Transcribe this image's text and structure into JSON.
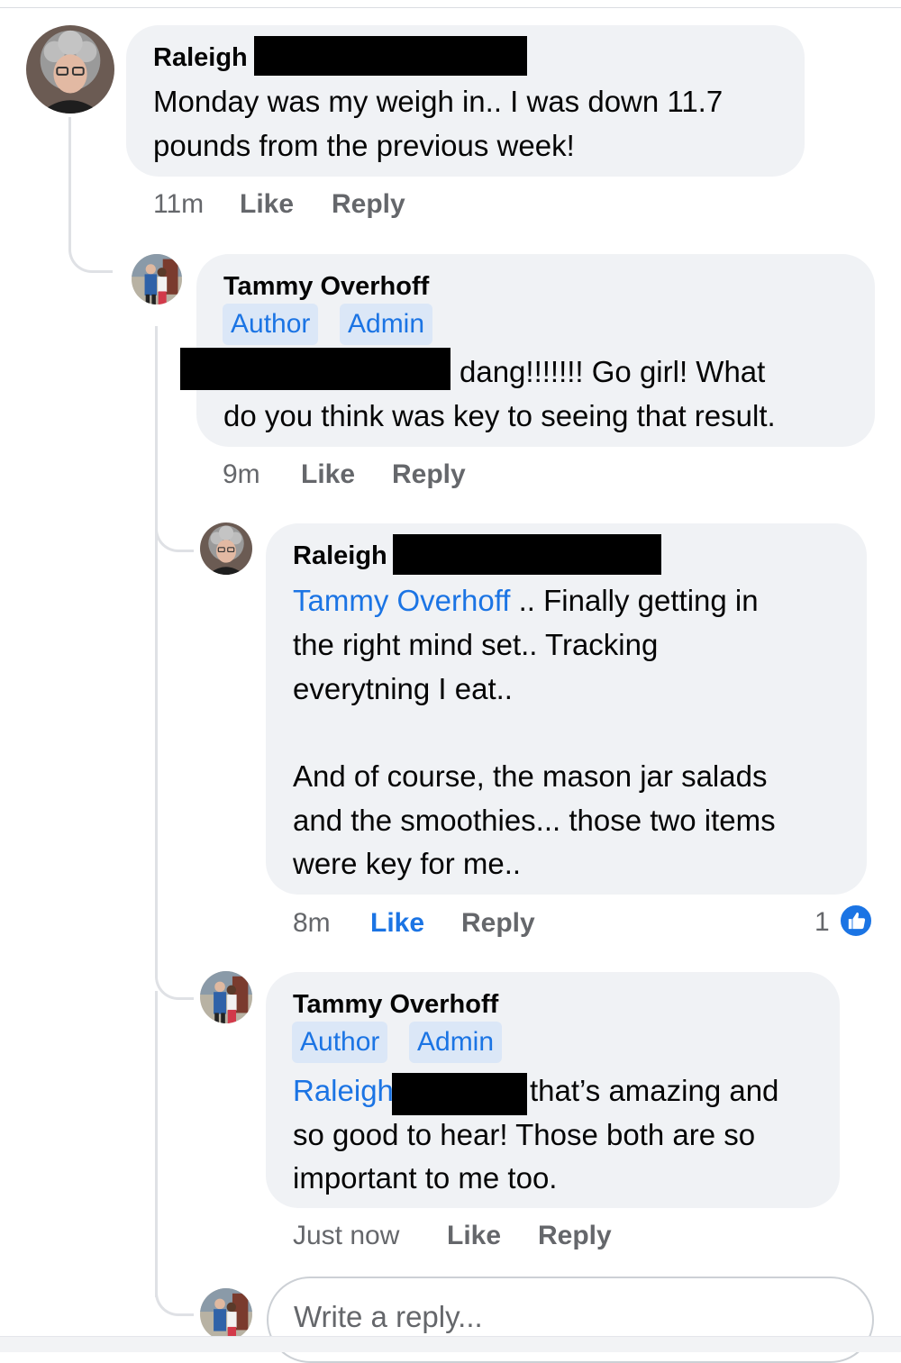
{
  "comments": [
    {
      "author": "Raleigh",
      "badges": [],
      "lines": [
        "Monday was my weigh in.. I was down 11.7",
        "pounds from the previous week!"
      ],
      "time": "11m",
      "like": "Like",
      "reply": "Reply"
    },
    {
      "author": "Tammy Overhoff",
      "badges": [
        "Author",
        "Admin"
      ],
      "lines": [
        "dang!!!!!!! Go girl! What",
        "do you think was key to seeing that result."
      ],
      "time": "9m",
      "like": "Like",
      "reply": "Reply"
    },
    {
      "author": "Raleigh",
      "badges": [],
      "mention": "Tammy Overhoff",
      "lines": [
        " .. Finally getting in",
        "the right mind set.. Tracking",
        "everytning I eat..",
        "And of course, the mason jar salads",
        "and the smoothies... those two items",
        "were key for me.."
      ],
      "time": "8m",
      "like": "Like",
      "reply": "Reply",
      "reaction_count": "1",
      "reaction_icon": "thumbs-up-icon"
    },
    {
      "author": "Tammy Overhoff",
      "badges": [
        "Author",
        "Admin"
      ],
      "mention": "Raleigh",
      "lines": [
        "that’s amazing and",
        "so good to hear! Those both are so",
        "important to me too."
      ],
      "time": "Just now",
      "like": "Like",
      "reply": "Reply"
    }
  ],
  "reply_box": {
    "placeholder": "Write a reply..."
  },
  "colors": {
    "bubble": "#f0f2f5",
    "accent": "#1b74e4",
    "meta": "#65676b",
    "badge_bg": "#dbe7f7"
  }
}
